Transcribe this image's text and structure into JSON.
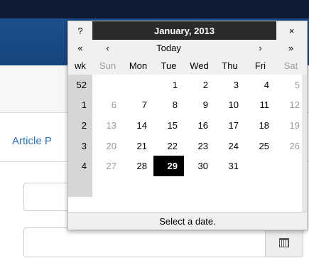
{
  "page": {
    "article_link": "Article P"
  },
  "calendar": {
    "title": "January, 2013",
    "help_label": "?",
    "close_label": "×",
    "nav": {
      "prev_year": "«",
      "prev_month": "‹",
      "today": "Today",
      "next_month": "›",
      "next_year": "»"
    },
    "headers": [
      "wk",
      "Sun",
      "Mon",
      "Tue",
      "Wed",
      "Thu",
      "Fri",
      "Sat"
    ],
    "weeks": [
      {
        "wk": "52",
        "days": [
          "",
          "",
          "1",
          "2",
          "3",
          "4",
          "5"
        ]
      },
      {
        "wk": "1",
        "days": [
          "6",
          "7",
          "8",
          "9",
          "10",
          "11",
          "12"
        ]
      },
      {
        "wk": "2",
        "days": [
          "13",
          "14",
          "15",
          "16",
          "17",
          "18",
          "19"
        ]
      },
      {
        "wk": "3",
        "days": [
          "20",
          "21",
          "22",
          "23",
          "24",
          "25",
          "26"
        ]
      },
      {
        "wk": "4",
        "days": [
          "27",
          "28",
          "29",
          "30",
          "31",
          "",
          ""
        ]
      }
    ],
    "selected_day": "29",
    "footer": "Select a date."
  },
  "icons": {
    "calendar_button": "calendar-icon"
  },
  "colors": {
    "title_bg": "#2b2b2b",
    "selected_bg": "#000000",
    "header_blue": "#1c4f8c",
    "link": "#2f73b5"
  }
}
